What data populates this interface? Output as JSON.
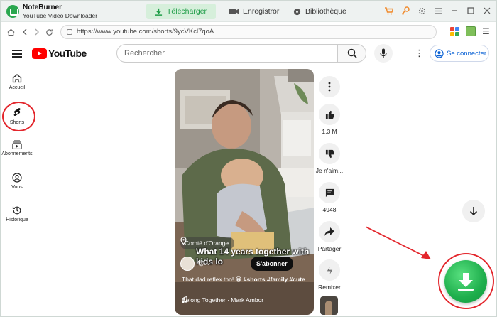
{
  "app": {
    "name": "NoteBurner",
    "subtitle": "YouTube Video Downloader",
    "tabs": [
      {
        "label": "Télécharger",
        "active": true
      },
      {
        "label": "Enregistror",
        "active": false
      },
      {
        "label": "Bibliothèque",
        "active": false
      }
    ]
  },
  "browser": {
    "url": "https://www.youtube.com/shorts/9ycVKcl7qoA"
  },
  "youtube": {
    "logo_text": "YouTube",
    "search_placeholder": "Rechercher",
    "signin_label": "Se connecter",
    "sidebar": [
      {
        "label": "Accueil",
        "icon": "home-icon"
      },
      {
        "label": "Shorts",
        "icon": "shorts-icon"
      },
      {
        "label": "Abonnements",
        "icon": "subscriptions-icon"
      },
      {
        "label": "Vous",
        "icon": "you-icon"
      },
      {
        "label": "Historique",
        "icon": "history-icon"
      }
    ]
  },
  "video": {
    "location": "Comté d'Orange",
    "title": "What 14 years together with kids lo",
    "channel_handle": "@...",
    "subscribe_label": "S'abonner",
    "caption_text": "That dad reflex tho! 😁 ",
    "caption_tags": "#shorts #family #cute",
    "music": "Belong Together · Mark Ambor"
  },
  "actions": {
    "likes": "1,3 M",
    "dislike_label": "Je n'aim...",
    "comments": "4948",
    "share_label": "Partager",
    "remix_label": "Remixer"
  },
  "colors": {
    "accent_green": "#1fae4c",
    "annotation_red": "#e3262c",
    "youtube_red": "#ff0000"
  }
}
